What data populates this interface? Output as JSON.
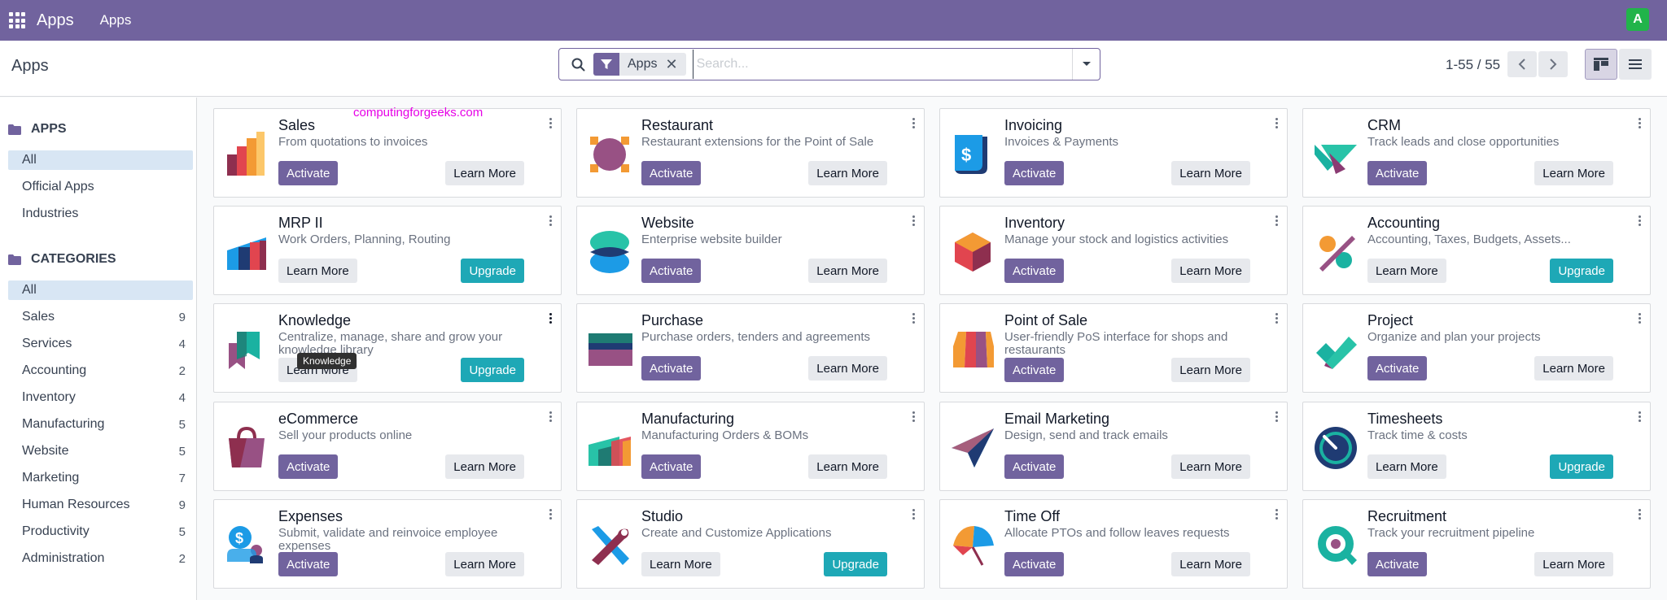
{
  "navbar": {
    "brand": "Apps",
    "menu": "Apps",
    "user_initial": "A"
  },
  "control": {
    "breadcrumb": "Apps",
    "search": {
      "facet_label": "Apps",
      "facet_close": "✕",
      "placeholder": "Search..."
    },
    "pager": "1-55 / 55"
  },
  "sidebar": {
    "apps_heading": "APPS",
    "apps_items": [
      {
        "label": "All"
      },
      {
        "label": "Official Apps"
      },
      {
        "label": "Industries"
      }
    ],
    "categories_heading": "CATEGORIES",
    "categories": [
      {
        "label": "All",
        "count": ""
      },
      {
        "label": "Sales",
        "count": "9"
      },
      {
        "label": "Services",
        "count": "4"
      },
      {
        "label": "Accounting",
        "count": "2"
      },
      {
        "label": "Inventory",
        "count": "4"
      },
      {
        "label": "Manufacturing",
        "count": "5"
      },
      {
        "label": "Website",
        "count": "5"
      },
      {
        "label": "Marketing",
        "count": "7"
      },
      {
        "label": "Human Resources",
        "count": "9"
      },
      {
        "label": "Productivity",
        "count": "5"
      },
      {
        "label": "Administration",
        "count": "2"
      }
    ]
  },
  "watermark": "computingforgeeks.com",
  "tooltip": "Knowledge",
  "apps": [
    {
      "name": "Sales",
      "summary": "From quotations to invoices",
      "left_btn": "Activate",
      "right_btn": "Learn More",
      "icon": "sales-icon"
    },
    {
      "name": "Restaurant",
      "summary": "Restaurant extensions for the Point of Sale",
      "left_btn": "Activate",
      "right_btn": "Learn More",
      "icon": "restaurant-icon"
    },
    {
      "name": "Invoicing",
      "summary": "Invoices & Payments",
      "left_btn": "Activate",
      "right_btn": "Learn More",
      "icon": "invoicing-icon"
    },
    {
      "name": "CRM",
      "summary": "Track leads and close opportunities",
      "left_btn": "Activate",
      "right_btn": "Learn More",
      "icon": "crm-icon"
    },
    {
      "name": "MRP II",
      "summary": "Work Orders, Planning, Routing",
      "left_btn": "Learn More",
      "right_btn": "Upgrade",
      "icon": "mrp-icon"
    },
    {
      "name": "Website",
      "summary": "Enterprise website builder",
      "left_btn": "Activate",
      "right_btn": "Learn More",
      "icon": "website-icon"
    },
    {
      "name": "Inventory",
      "summary": "Manage your stock and logistics activities",
      "left_btn": "Activate",
      "right_btn": "Learn More",
      "icon": "inventory-icon"
    },
    {
      "name": "Accounting",
      "summary": "Accounting, Taxes, Budgets, Assets...",
      "left_btn": "Learn More",
      "right_btn": "Upgrade",
      "icon": "accounting-icon"
    },
    {
      "name": "Knowledge",
      "summary": "Centralize, manage, share and grow your knowledge library",
      "left_btn": "Learn More",
      "right_btn": "Upgrade",
      "icon": "knowledge-icon"
    },
    {
      "name": "Purchase",
      "summary": "Purchase orders, tenders and agreements",
      "left_btn": "Activate",
      "right_btn": "Learn More",
      "icon": "purchase-icon"
    },
    {
      "name": "Point of Sale",
      "summary": "User-friendly PoS interface for shops and restaurants",
      "left_btn": "Activate",
      "right_btn": "Learn More",
      "icon": "point-of-sale-icon"
    },
    {
      "name": "Project",
      "summary": "Organize and plan your projects",
      "left_btn": "Activate",
      "right_btn": "Learn More",
      "icon": "project-icon"
    },
    {
      "name": "eCommerce",
      "summary": "Sell your products online",
      "left_btn": "Activate",
      "right_btn": "Learn More",
      "icon": "ecommerce-icon"
    },
    {
      "name": "Manufacturing",
      "summary": "Manufacturing Orders & BOMs",
      "left_btn": "Activate",
      "right_btn": "Learn More",
      "icon": "manufacturing-icon"
    },
    {
      "name": "Email Marketing",
      "summary": "Design, send and track emails",
      "left_btn": "Activate",
      "right_btn": "Learn More",
      "icon": "email-marketing-icon"
    },
    {
      "name": "Timesheets",
      "summary": "Track time & costs",
      "left_btn": "Learn More",
      "right_btn": "Upgrade",
      "icon": "timesheets-icon"
    },
    {
      "name": "Expenses",
      "summary": "Submit, validate and reinvoice employee expenses",
      "left_btn": "Activate",
      "right_btn": "Learn More",
      "icon": "expenses-icon"
    },
    {
      "name": "Studio",
      "summary": "Create and Customize Applications",
      "left_btn": "Learn More",
      "right_btn": "Upgrade",
      "icon": "studio-icon"
    },
    {
      "name": "Time Off",
      "summary": "Allocate PTOs and follow leaves requests",
      "left_btn": "Activate",
      "right_btn": "Learn More",
      "icon": "time-off-icon"
    },
    {
      "name": "Recruitment",
      "summary": "Track your recruitment pipeline",
      "left_btn": "Activate",
      "right_btn": "Learn More",
      "icon": "recruitment-icon"
    }
  ]
}
